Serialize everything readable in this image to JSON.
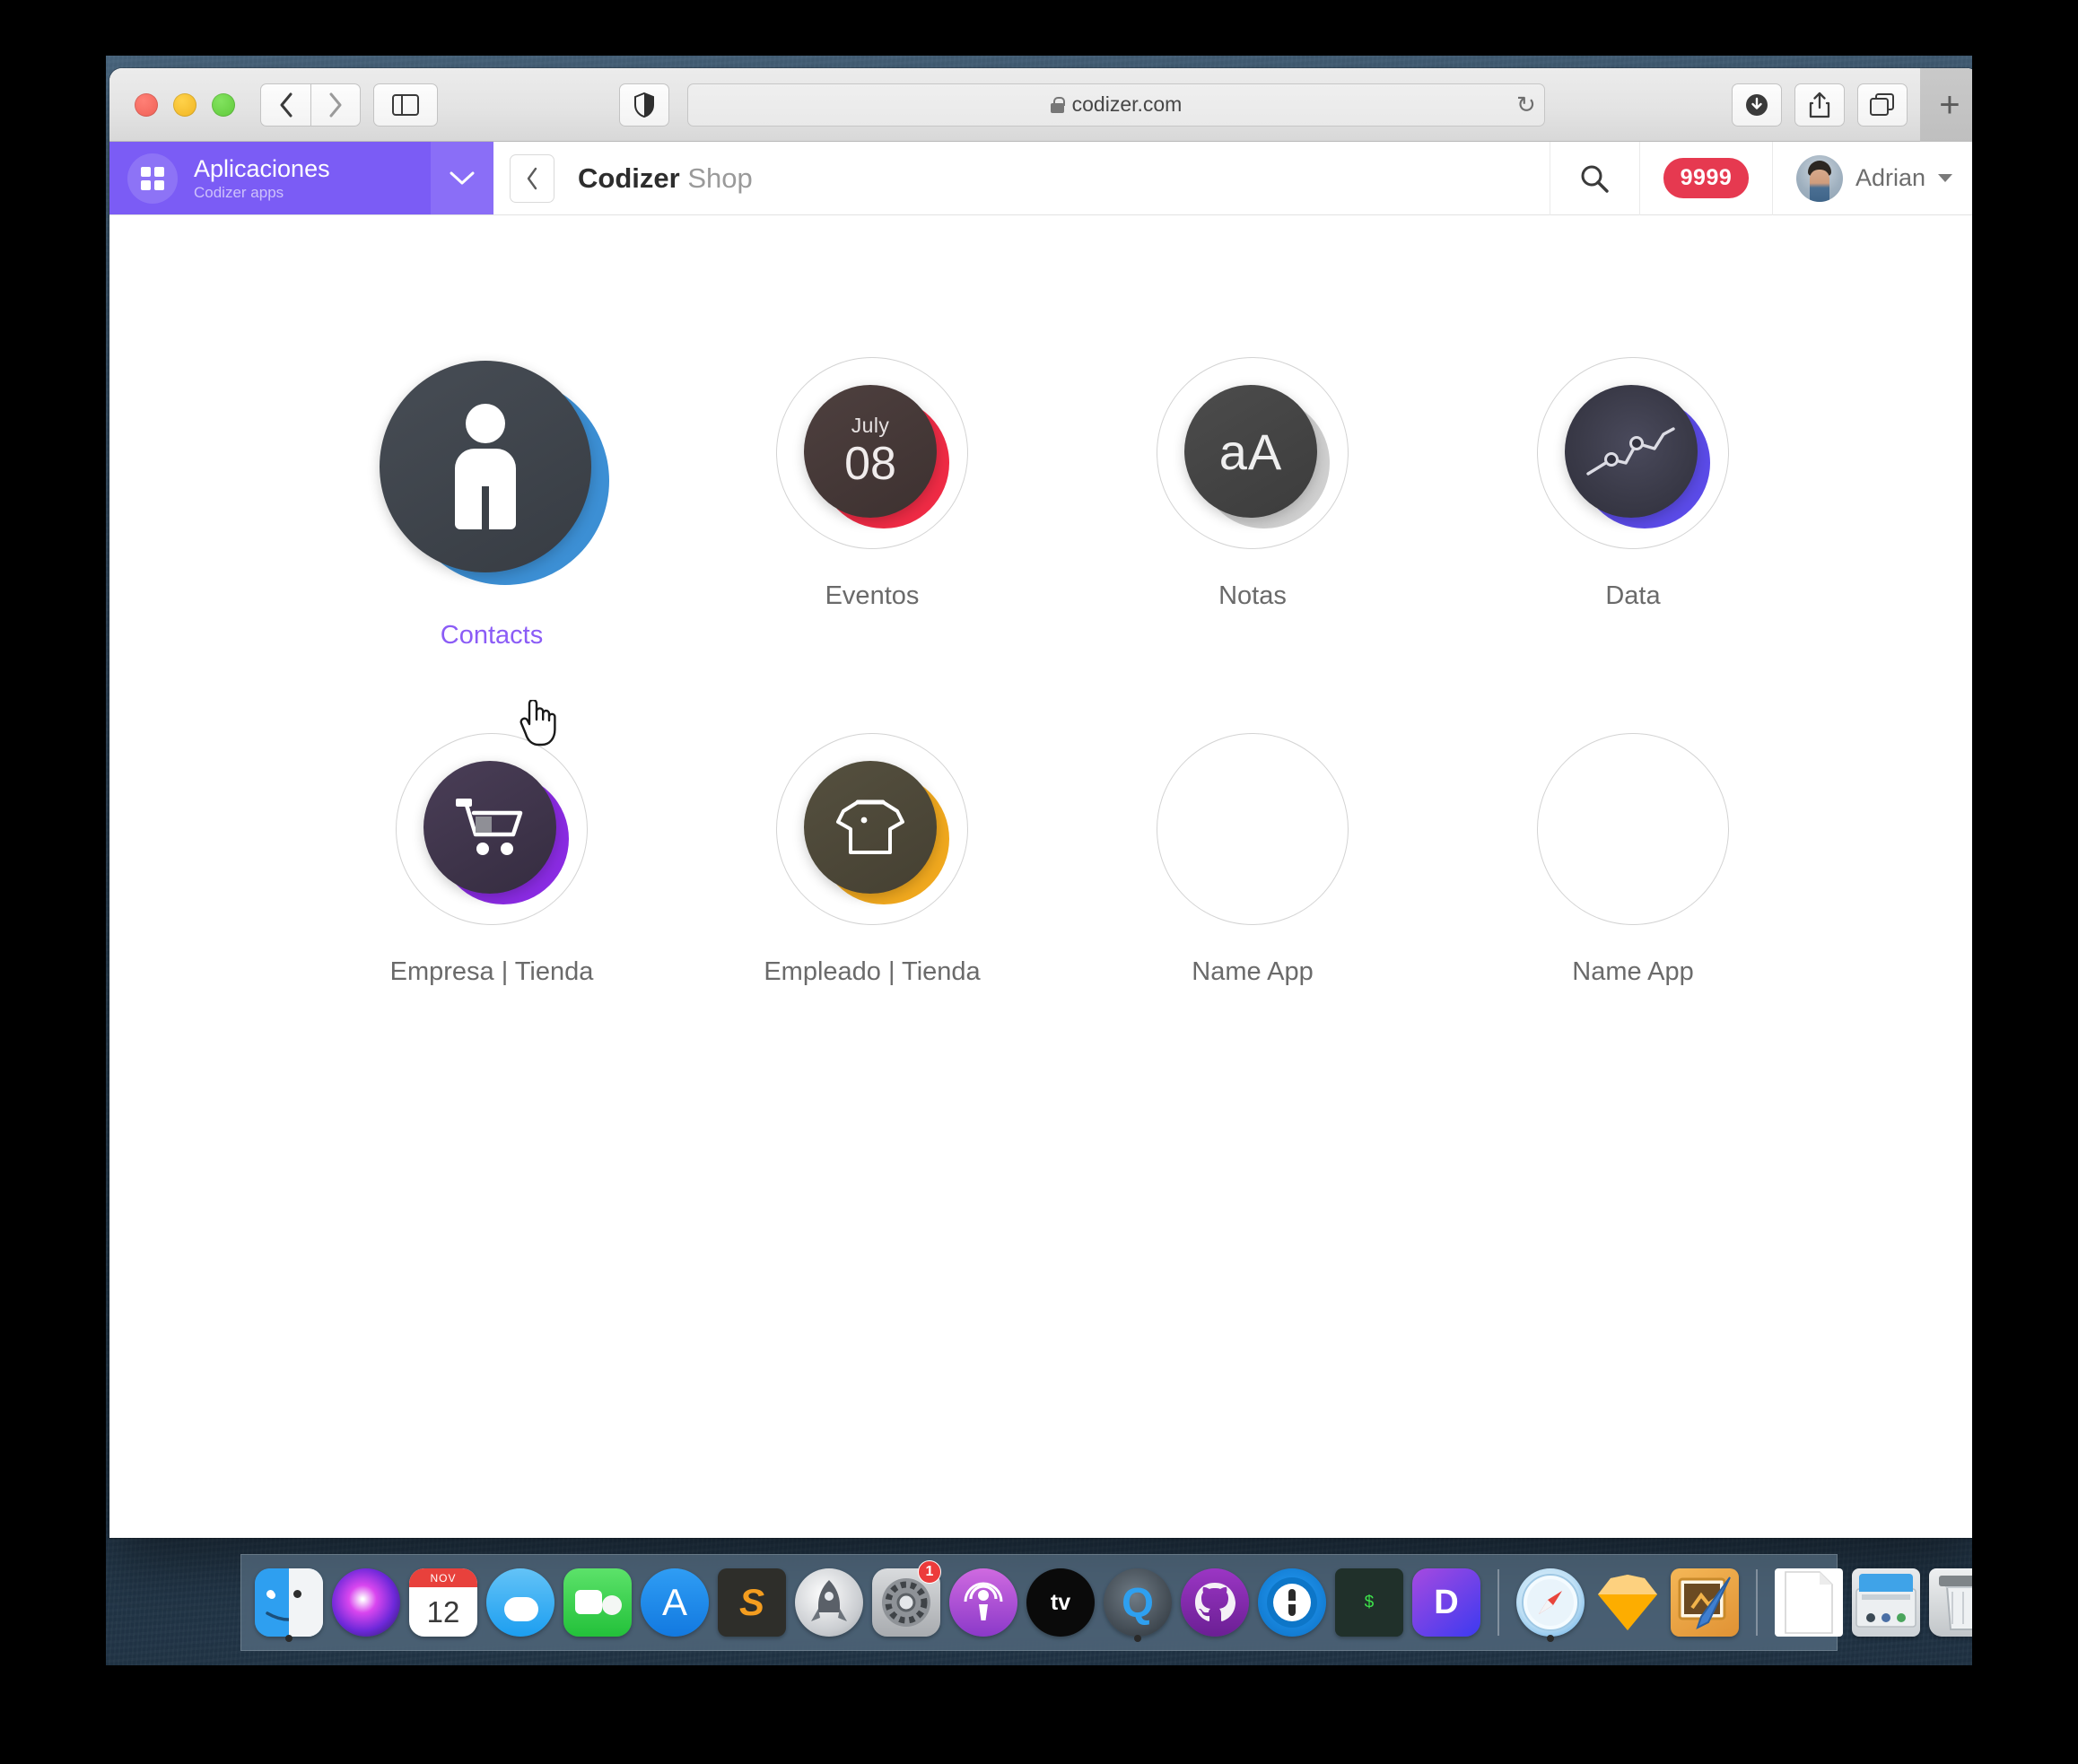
{
  "browser": {
    "url": "codizer.com",
    "url_secure_icon": "lock-icon",
    "back_icon": "chevron-left-icon",
    "forward_icon": "chevron-right-icon",
    "sidebar_icon": "sidebar-toggle-icon",
    "shield_icon": "privacy-shield-icon",
    "reload_icon": "reload-icon",
    "download_icon": "download-icon",
    "share_icon": "share-icon",
    "tabs_icon": "tab-overview-icon",
    "newtab_label": "+"
  },
  "app_switcher": {
    "icon": "grid-apps-icon",
    "title": "Aplicaciones",
    "subtitle": "Codizer apps",
    "chevron_icon": "chevron-down-icon",
    "color": "#7b5cf5"
  },
  "header": {
    "back_icon": "chevron-left-icon",
    "title_bold": "Codizer",
    "title_rest": "Shop",
    "search_icon": "search-icon",
    "badge_count": "9999",
    "badge_color": "#e63950",
    "user_name": "Adrian",
    "user_avatar": "user-avatar",
    "user_caret_icon": "caret-down-icon"
  },
  "apps": [
    {
      "label": "Contacts",
      "icon": "person-icon",
      "accent": "#3c8fd4",
      "active": true,
      "empty": false,
      "size": "large"
    },
    {
      "label": "Eventos",
      "icon": "calendar-date-icon",
      "accent": "#ef2b45",
      "active": false,
      "empty": false,
      "month": "July",
      "day": "08"
    },
    {
      "label": "Notas",
      "icon": "text-aa-icon",
      "accent": "#c9c9c9",
      "active": false,
      "empty": false,
      "glyph": "aA"
    },
    {
      "label": "Data",
      "icon": "line-chart-icon",
      "accent": "#5b4be8",
      "active": false,
      "empty": false
    },
    {
      "label": "Empresa | Tienda",
      "icon": "shopping-cart-icon",
      "accent": "#8a2be2",
      "active": false,
      "empty": false
    },
    {
      "label": "Empleado | Tienda",
      "icon": "tshirt-icon",
      "accent": "#f0a81e",
      "active": false,
      "empty": false
    },
    {
      "label": "Name App",
      "icon": "empty-app-icon",
      "accent": "",
      "active": false,
      "empty": true
    },
    {
      "label": "Name App",
      "icon": "empty-app-icon",
      "accent": "",
      "active": false,
      "empty": true
    }
  ],
  "cursor": {
    "icon": "pointing-hand-cursor"
  },
  "dock": {
    "items": [
      {
        "name": "finder",
        "label": "Finder",
        "class": "ic-finder",
        "round": false,
        "running": true
      },
      {
        "name": "siri",
        "label": "Siri",
        "class": "ic-siri",
        "round": true,
        "running": false
      },
      {
        "name": "calendar",
        "label": "Calendar",
        "class": "ic-cal",
        "round": false,
        "running": false,
        "cal_month": "NOV",
        "cal_day": "12"
      },
      {
        "name": "messages",
        "label": "Messages",
        "class": "ic-msg",
        "round": true,
        "running": false
      },
      {
        "name": "facetime",
        "label": "FaceTime",
        "class": "ic-ft",
        "round": false,
        "running": false
      },
      {
        "name": "app-store",
        "label": "App Store",
        "class": "ic-appstore",
        "round": true,
        "running": false,
        "glyph": "A"
      },
      {
        "name": "sublime-text",
        "label": "Sublime Text",
        "class": "ic-sublime",
        "round": false,
        "running": false,
        "glyph": "S"
      },
      {
        "name": "launchpad",
        "label": "Launchpad",
        "class": "ic-launch",
        "round": true,
        "running": false
      },
      {
        "name": "system-preferences",
        "label": "System Preferences",
        "class": "ic-prefs",
        "round": false,
        "running": false,
        "badge": "1"
      },
      {
        "name": "podcasts",
        "label": "Podcasts",
        "class": "ic-podcast",
        "round": true,
        "running": false
      },
      {
        "name": "apple-tv",
        "label": "TV",
        "class": "ic-tv",
        "round": true,
        "running": false,
        "glyph": "tv"
      },
      {
        "name": "quicktime",
        "label": "QuickTime Player",
        "class": "ic-qt",
        "round": true,
        "running": true
      },
      {
        "name": "github-desktop",
        "label": "GitHub Desktop",
        "class": "ic-github",
        "round": true,
        "running": false
      },
      {
        "name": "1password",
        "label": "1Password",
        "class": "ic-1pwd",
        "round": true,
        "running": false
      },
      {
        "name": "terminal",
        "label": "Terminal",
        "class": "ic-term",
        "round": false,
        "running": false,
        "glyph": "$"
      },
      {
        "name": "dash",
        "label": "Dash",
        "class": "ic-dash",
        "round": false,
        "running": false,
        "glyph": "D"
      },
      {
        "name": "separator-1",
        "label": "",
        "class": "sep",
        "round": false,
        "running": false
      },
      {
        "name": "safari",
        "label": "Safari",
        "class": "ic-safari",
        "round": true,
        "running": true
      },
      {
        "name": "sketch",
        "label": "Sketch",
        "class": "ic-sketch",
        "round": false,
        "running": false
      },
      {
        "name": "pixelmator",
        "label": "Pixelmator",
        "class": "ic-pixel",
        "round": false,
        "running": false
      },
      {
        "name": "separator-2",
        "label": "",
        "class": "sep",
        "round": false,
        "running": false
      },
      {
        "name": "document",
        "label": "Document",
        "class": "ic-doc",
        "round": false,
        "running": false
      },
      {
        "name": "downloads",
        "label": "Downloads",
        "class": "ic-folder",
        "round": false,
        "running": false
      },
      {
        "name": "trash",
        "label": "Trash",
        "class": "ic-trash",
        "round": false,
        "running": false
      }
    ]
  }
}
